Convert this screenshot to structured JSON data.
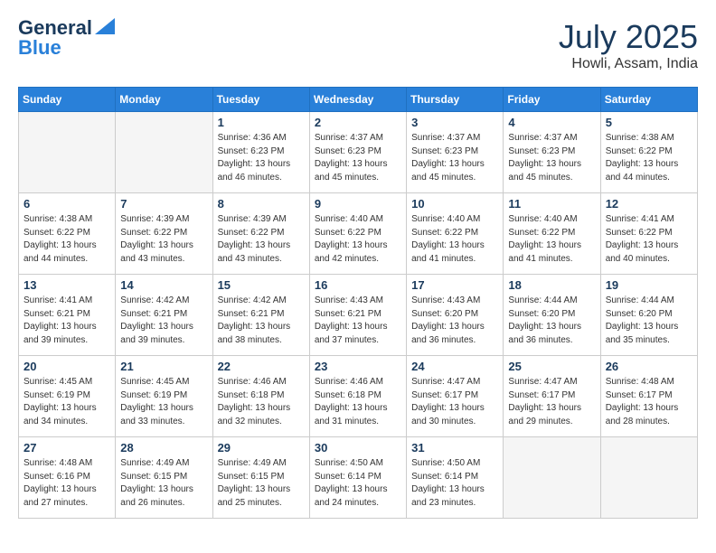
{
  "header": {
    "logo_line1": "General",
    "logo_line2": "Blue",
    "month": "July 2025",
    "location": "Howli, Assam, India"
  },
  "weekdays": [
    "Sunday",
    "Monday",
    "Tuesday",
    "Wednesday",
    "Thursday",
    "Friday",
    "Saturday"
  ],
  "weeks": [
    [
      {
        "day": "",
        "empty": true
      },
      {
        "day": "",
        "empty": true
      },
      {
        "day": "1",
        "sunrise": "4:36 AM",
        "sunset": "6:23 PM",
        "daylight": "13 hours and 46 minutes."
      },
      {
        "day": "2",
        "sunrise": "4:37 AM",
        "sunset": "6:23 PM",
        "daylight": "13 hours and 45 minutes."
      },
      {
        "day": "3",
        "sunrise": "4:37 AM",
        "sunset": "6:23 PM",
        "daylight": "13 hours and 45 minutes."
      },
      {
        "day": "4",
        "sunrise": "4:37 AM",
        "sunset": "6:23 PM",
        "daylight": "13 hours and 45 minutes."
      },
      {
        "day": "5",
        "sunrise": "4:38 AM",
        "sunset": "6:22 PM",
        "daylight": "13 hours and 44 minutes."
      }
    ],
    [
      {
        "day": "6",
        "sunrise": "4:38 AM",
        "sunset": "6:22 PM",
        "daylight": "13 hours and 44 minutes."
      },
      {
        "day": "7",
        "sunrise": "4:39 AM",
        "sunset": "6:22 PM",
        "daylight": "13 hours and 43 minutes."
      },
      {
        "day": "8",
        "sunrise": "4:39 AM",
        "sunset": "6:22 PM",
        "daylight": "13 hours and 43 minutes."
      },
      {
        "day": "9",
        "sunrise": "4:40 AM",
        "sunset": "6:22 PM",
        "daylight": "13 hours and 42 minutes."
      },
      {
        "day": "10",
        "sunrise": "4:40 AM",
        "sunset": "6:22 PM",
        "daylight": "13 hours and 41 minutes."
      },
      {
        "day": "11",
        "sunrise": "4:40 AM",
        "sunset": "6:22 PM",
        "daylight": "13 hours and 41 minutes."
      },
      {
        "day": "12",
        "sunrise": "4:41 AM",
        "sunset": "6:22 PM",
        "daylight": "13 hours and 40 minutes."
      }
    ],
    [
      {
        "day": "13",
        "sunrise": "4:41 AM",
        "sunset": "6:21 PM",
        "daylight": "13 hours and 39 minutes."
      },
      {
        "day": "14",
        "sunrise": "4:42 AM",
        "sunset": "6:21 PM",
        "daylight": "13 hours and 39 minutes."
      },
      {
        "day": "15",
        "sunrise": "4:42 AM",
        "sunset": "6:21 PM",
        "daylight": "13 hours and 38 minutes."
      },
      {
        "day": "16",
        "sunrise": "4:43 AM",
        "sunset": "6:21 PM",
        "daylight": "13 hours and 37 minutes."
      },
      {
        "day": "17",
        "sunrise": "4:43 AM",
        "sunset": "6:20 PM",
        "daylight": "13 hours and 36 minutes."
      },
      {
        "day": "18",
        "sunrise": "4:44 AM",
        "sunset": "6:20 PM",
        "daylight": "13 hours and 36 minutes."
      },
      {
        "day": "19",
        "sunrise": "4:44 AM",
        "sunset": "6:20 PM",
        "daylight": "13 hours and 35 minutes."
      }
    ],
    [
      {
        "day": "20",
        "sunrise": "4:45 AM",
        "sunset": "6:19 PM",
        "daylight": "13 hours and 34 minutes."
      },
      {
        "day": "21",
        "sunrise": "4:45 AM",
        "sunset": "6:19 PM",
        "daylight": "13 hours and 33 minutes."
      },
      {
        "day": "22",
        "sunrise": "4:46 AM",
        "sunset": "6:18 PM",
        "daylight": "13 hours and 32 minutes."
      },
      {
        "day": "23",
        "sunrise": "4:46 AM",
        "sunset": "6:18 PM",
        "daylight": "13 hours and 31 minutes."
      },
      {
        "day": "24",
        "sunrise": "4:47 AM",
        "sunset": "6:17 PM",
        "daylight": "13 hours and 30 minutes."
      },
      {
        "day": "25",
        "sunrise": "4:47 AM",
        "sunset": "6:17 PM",
        "daylight": "13 hours and 29 minutes."
      },
      {
        "day": "26",
        "sunrise": "4:48 AM",
        "sunset": "6:17 PM",
        "daylight": "13 hours and 28 minutes."
      }
    ],
    [
      {
        "day": "27",
        "sunrise": "4:48 AM",
        "sunset": "6:16 PM",
        "daylight": "13 hours and 27 minutes."
      },
      {
        "day": "28",
        "sunrise": "4:49 AM",
        "sunset": "6:15 PM",
        "daylight": "13 hours and 26 minutes."
      },
      {
        "day": "29",
        "sunrise": "4:49 AM",
        "sunset": "6:15 PM",
        "daylight": "13 hours and 25 minutes."
      },
      {
        "day": "30",
        "sunrise": "4:50 AM",
        "sunset": "6:14 PM",
        "daylight": "13 hours and 24 minutes."
      },
      {
        "day": "31",
        "sunrise": "4:50 AM",
        "sunset": "6:14 PM",
        "daylight": "13 hours and 23 minutes."
      },
      {
        "day": "",
        "empty": true
      },
      {
        "day": "",
        "empty": true
      }
    ]
  ]
}
